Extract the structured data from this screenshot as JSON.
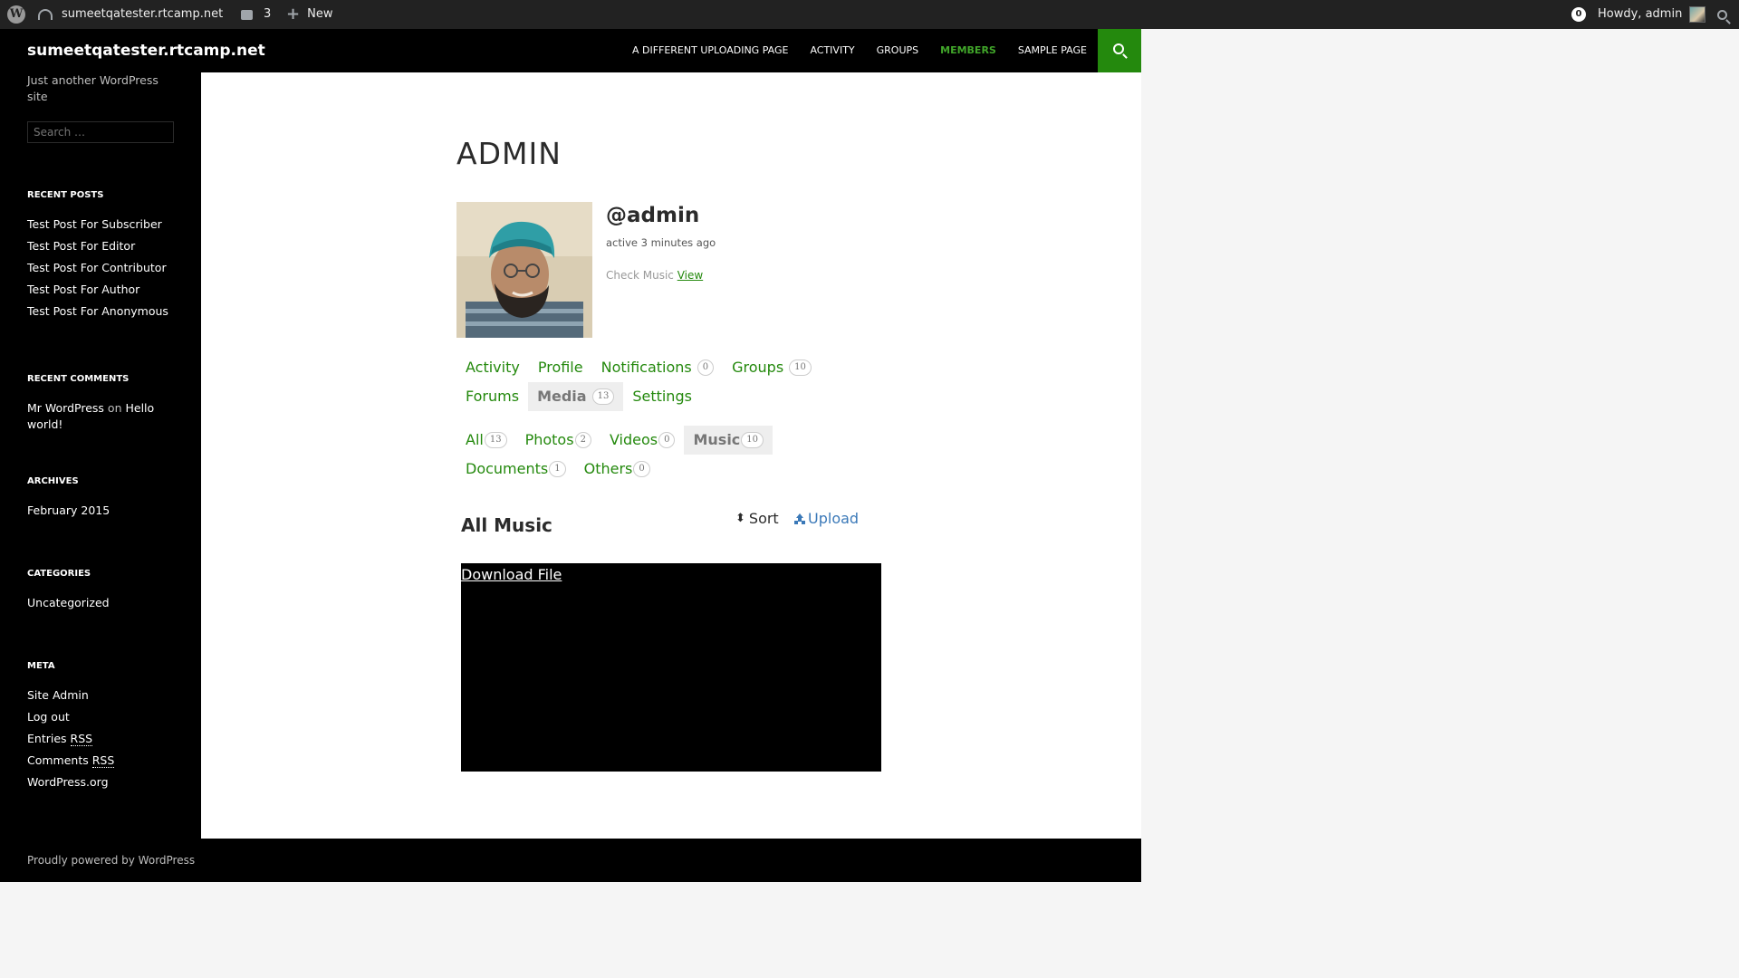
{
  "adminbar": {
    "site_name": "sumeetqatester.rtcamp.net",
    "comments_count": "3",
    "new_label": "New",
    "notifications_count": "0",
    "howdy": "Howdy, admin"
  },
  "header": {
    "site_title": "sumeetqatester.rtcamp.net",
    "nav": [
      "A DIFFERENT UPLOADING PAGE",
      "ACTIVITY",
      "GROUPS",
      "MEMBERS",
      "SAMPLE PAGE"
    ],
    "current_nav": "MEMBERS"
  },
  "sidebar": {
    "description": "Just another WordPress site",
    "search_placeholder": "Search …",
    "recent_posts": {
      "title": "RECENT POSTS",
      "items": [
        "Test Post For Subscriber",
        "Test Post For Editor",
        "Test Post For Contributor",
        "Test Post For Author",
        "Test Post For Anonymous"
      ]
    },
    "recent_comments": {
      "title": "RECENT COMMENTS",
      "author": "Mr WordPress",
      "on": "on",
      "post": "Hello world!"
    },
    "archives": {
      "title": "ARCHIVES",
      "items": [
        "February 2015"
      ]
    },
    "categories": {
      "title": "CATEGORIES",
      "items": [
        "Uncategorized"
      ]
    },
    "meta": {
      "title": "META",
      "site_admin": "Site Admin",
      "log_out": "Log out",
      "entries": "Entries",
      "comments": "Comments",
      "rss": "RSS",
      "wordpress_org": "WordPress.org"
    }
  },
  "profile": {
    "page_title": "ADMIN",
    "username": "@admin",
    "active": "active 3 minutes ago",
    "check_music": "Check Music",
    "view_link": "View",
    "tabs": [
      {
        "label": "Activity",
        "count": null
      },
      {
        "label": "Profile",
        "count": null
      },
      {
        "label": "Notifications",
        "count": "0"
      },
      {
        "label": "Groups",
        "count": "10"
      },
      {
        "label": "Forums",
        "count": null
      },
      {
        "label": "Media",
        "count": "13"
      },
      {
        "label": "Settings",
        "count": null
      }
    ],
    "media_tabs": [
      {
        "label": "All",
        "count": "13"
      },
      {
        "label": "Photos",
        "count": "2"
      },
      {
        "label": "Videos",
        "count": "0"
      },
      {
        "label": "Music",
        "count": "10"
      },
      {
        "label": "Documents",
        "count": "1"
      },
      {
        "label": "Others",
        "count": "0"
      }
    ]
  },
  "media": {
    "title": "All Music",
    "sort_label": "Sort",
    "upload_label": "Upload",
    "download_link": "Download File"
  },
  "footer": {
    "text": "Proudly powered by WordPress"
  },
  "colors": {
    "accent": "#24890d",
    "accent_light": "#41a62a",
    "link_blue": "#3b79b8"
  }
}
